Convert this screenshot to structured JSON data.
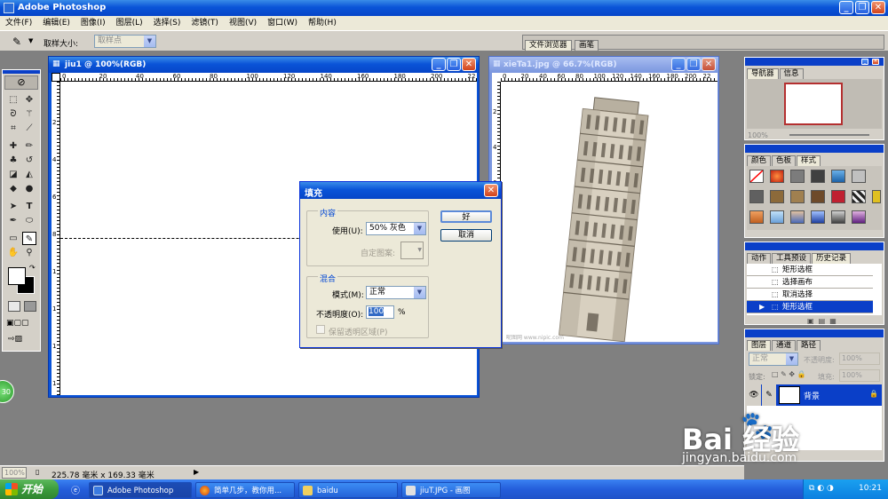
{
  "app": {
    "title": "Adobe Photoshop"
  },
  "menu": {
    "items": [
      "文件(F)",
      "编辑(E)",
      "图像(I)",
      "图层(L)",
      "选择(S)",
      "滤镜(T)",
      "视图(V)",
      "窗口(W)",
      "帮助(H)"
    ]
  },
  "options_bar": {
    "sample_size_label": "取样大小:",
    "sample_size_value": "取样点",
    "file_browser_tab": "文件浏览器",
    "brushes_tab": "画笔"
  },
  "doc1": {
    "title": "jiu1 @ 100%(RGB)",
    "ruler_h": [
      "0",
      "20",
      "40",
      "60",
      "80",
      "100",
      "120",
      "140",
      "160",
      "180",
      "200",
      "22"
    ],
    "ruler_v": [
      "2",
      "4",
      "6",
      "8",
      "1",
      "1",
      "1",
      "1"
    ]
  },
  "doc2": {
    "title": "xieTa1.jpg @ 66.7%(RGB)",
    "ruler_h": [
      "0",
      "20",
      "40",
      "60",
      "80",
      "100",
      "120",
      "140",
      "160",
      "180",
      "200",
      "22"
    ],
    "ruler_v": [
      "2",
      "4",
      "6",
      "8",
      "1",
      "1"
    ],
    "watermark": "昵图网 www.nipic.com"
  },
  "fill_dialog": {
    "title": "填充",
    "content_group": "内容",
    "use_label": "使用(U):",
    "use_value": "50% 灰色",
    "custom_pattern_label": "自定图案:",
    "blending_group": "混合",
    "mode_label": "模式(M):",
    "mode_value": "正常",
    "opacity_label": "不透明度(O):",
    "opacity_value": "100",
    "opacity_unit": "%",
    "preserve_label": "保留透明区域(P)",
    "ok_label": "好",
    "cancel_label": "取消"
  },
  "navigator": {
    "tabs": [
      "导航器",
      "信息"
    ],
    "zoom": "100%"
  },
  "color_panel": {
    "tabs": [
      "颜色",
      "色板",
      "样式"
    ]
  },
  "history_panel": {
    "tabs": [
      "动作",
      "工具预设",
      "历史记录"
    ],
    "items": [
      "矩形选框",
      "选择画布",
      "取消选择",
      "矩形选框"
    ]
  },
  "layers_panel": {
    "tabs": [
      "图层",
      "通道",
      "路径"
    ],
    "mode": "正常",
    "opacity_label": "不透明度:",
    "opacity_value": "100%",
    "lock_label": "锁定:",
    "fill_label": "填充:",
    "fill_value": "100%",
    "layer_name": "背景"
  },
  "status_bar": {
    "zoom": "100%",
    "doc_size": "225.78 毫米 x 169.33 毫米"
  },
  "badge": "30",
  "taskbar": {
    "start_label": "开始",
    "buttons": [
      "Adobe Photoshop",
      "简单几步，教你用...",
      "baidu",
      "jiuT.JPG - 画图"
    ],
    "clock": "10:21"
  },
  "watermark": {
    "brand": "Bai 经验",
    "url": "jingyan.baidu.com"
  },
  "colors": {
    "title_blue": "#0a54d8",
    "taskbar_blue": "#245edb",
    "start_green": "#3c9c3c",
    "panel_gray": "#d4d0c8"
  }
}
